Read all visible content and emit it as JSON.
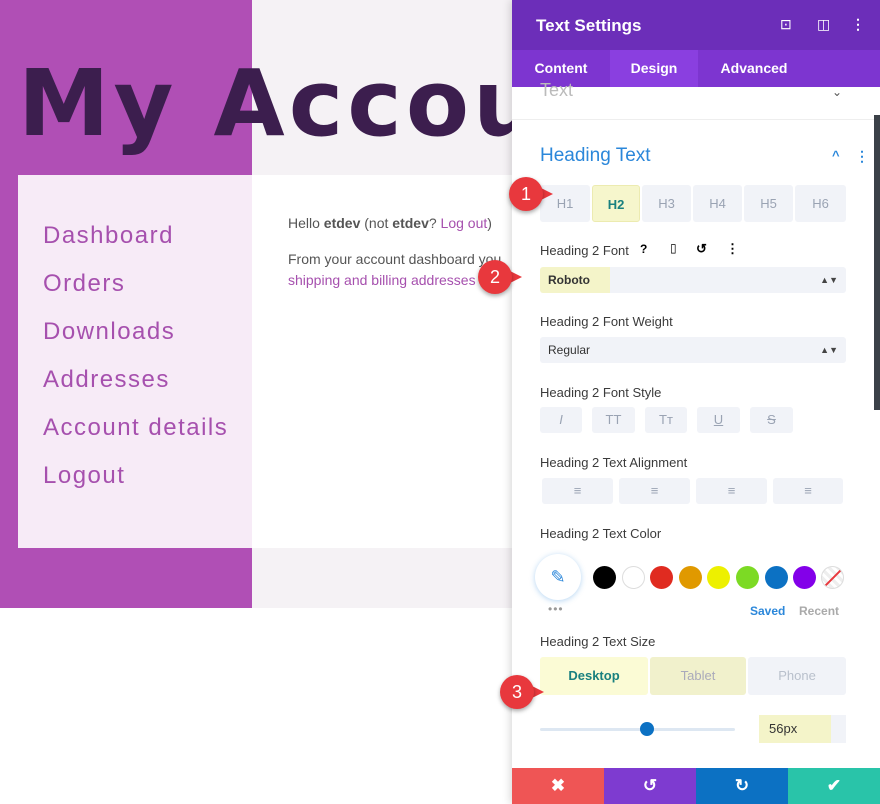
{
  "page": {
    "title": "My Accoun",
    "menu": [
      "Dashboard",
      "Orders",
      "Downloads",
      "Addresses",
      "Account details",
      "Logout"
    ],
    "hello_prefix": "Hello ",
    "user": "etdev",
    "hello_mid": " (not ",
    "user2": "etdev",
    "hello_q": "? ",
    "logout_link": "Log out",
    "hello_end": ")",
    "dashboard_text": "From your account dashboard you",
    "addresses_link": "shipping and billing addresses"
  },
  "panel": {
    "title": "Text Settings",
    "tabs": [
      "Content",
      "Design",
      "Advanced"
    ],
    "active_tab": "Design",
    "collapsed_section": "Text",
    "section": "Heading Text",
    "heading_levels": [
      "H1",
      "H2",
      "H3",
      "H4",
      "H5",
      "H6"
    ],
    "active_level": "H2",
    "font_label": "Heading 2 Font",
    "font_value": "Roboto",
    "weight_label": "Heading 2 Font Weight",
    "weight_value": "Regular",
    "style_label": "Heading 2 Font Style",
    "style_buttons": [
      "I",
      "TT",
      "Tт",
      "U",
      "S"
    ],
    "align_label": "Heading 2 Text Alignment",
    "color_label": "Heading 2 Text Color",
    "swatches": [
      "#000000",
      "#ffffff",
      "#e02b20",
      "#e09900",
      "#edf000",
      "#7cda24",
      "#0c71c3",
      "#8300e9"
    ],
    "saved": "Saved",
    "recent": "Recent",
    "size_label": "Heading 2 Text Size",
    "devices": [
      "Desktop",
      "Tablet",
      "Phone"
    ],
    "size_value": "56px",
    "slider_fraction": 0.55
  },
  "annotations": [
    "1",
    "2",
    "3"
  ],
  "colors": {
    "header": "#6c2eb9",
    "tabs": "#7d35d0",
    "accent": "#2b87da",
    "highlight": "#f4f4c9",
    "cancel": "#ef5555",
    "undo": "#7e3bd0",
    "redo": "#0c71c3",
    "save": "#29c4a9"
  }
}
